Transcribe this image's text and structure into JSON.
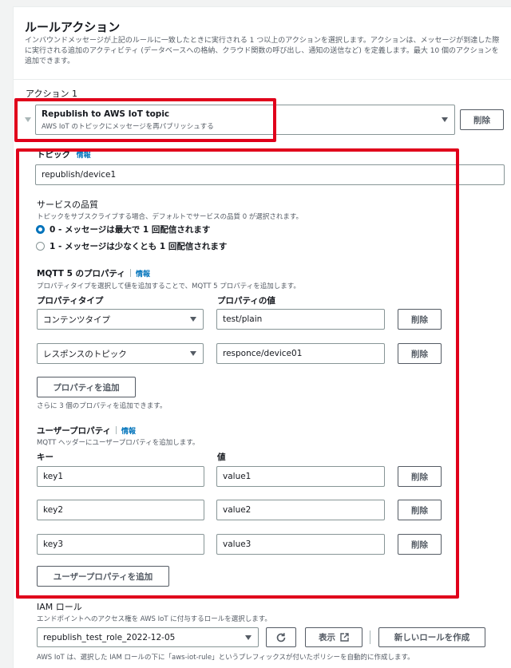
{
  "header": {
    "title": "ルールアクション",
    "description": "インバウンドメッセージが上記のルールに一致したときに実行される 1 つ以上のアクションを選択します。アクションは、メッセージが到達した際に実行される追加のアクティビティ (データベースへの格納、クラウド関数の呼び出し、通知の送信など) を定義します。最大 10 個のアクションを追加できます。"
  },
  "action": {
    "label": "アクション 1",
    "select_title": "Republish to AWS IoT topic",
    "select_subtitle": "AWS IoT のトピックにメッセージを再パブリッシュする",
    "delete_label": "削除"
  },
  "topic": {
    "label": "トピック",
    "info": "情報",
    "value": "republish/device1"
  },
  "qos": {
    "label": "サービスの品質",
    "description": "トピックをサブスクライブする場合、デフォルトでサービスの品質 0 が選択されます。",
    "options": [
      {
        "label": "0 - メッセージは最大で 1 回配信されます",
        "selected": true
      },
      {
        "label": "1 - メッセージは少なくとも 1 回配信されます",
        "selected": false
      }
    ]
  },
  "mqtt5": {
    "label": "MQTT 5 のプロパティ",
    "info": "情報",
    "description": "プロパティタイプを選択して値を追加することで、MQTT 5 プロパティを追加します。",
    "type_header": "プロパティタイプ",
    "value_header": "プロパティの値",
    "rows": [
      {
        "type": "コンテンツタイプ",
        "value": "test/plain",
        "delete": "削除"
      },
      {
        "type": "レスポンスのトピック",
        "value": "responce/device01",
        "delete": "削除"
      }
    ],
    "add_button": "プロパティを追加",
    "remaining": "さらに 3 個のプロパティを追加できます。"
  },
  "user_props": {
    "label": "ユーザープロパティ",
    "info": "情報",
    "description": "MQTT ヘッダーにユーザープロパティを追加します。",
    "key_header": "キー",
    "value_header": "値",
    "rows": [
      {
        "key": "key1",
        "value": "value1",
        "delete": "削除"
      },
      {
        "key": "key2",
        "value": "value2",
        "delete": "削除"
      },
      {
        "key": "key3",
        "value": "value3",
        "delete": "削除"
      }
    ],
    "add_button": "ユーザープロパティを追加"
  },
  "iam": {
    "label": "IAM ロール",
    "description": "エンドポイントへのアクセス権を AWS IoT に付与するロールを選択します。",
    "role": "republish_test_role_2022-12-05",
    "view_button": "表示",
    "create_button": "新しいロールを作成",
    "footnote": "AWS IoT は、選択した IAM ロールの下に「aws-iot-rule」というプレフィックスが付いたポリシーを自動的に作成します。"
  },
  "colors": {
    "highlight": "#e0001b",
    "link": "#0073bb",
    "radio_selected": "#0073bb"
  }
}
